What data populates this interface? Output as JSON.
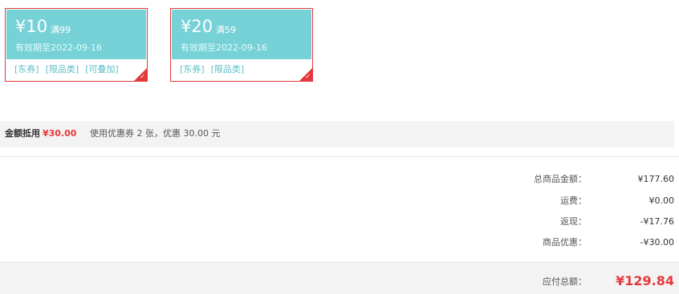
{
  "coupons": [
    {
      "amount": "¥10",
      "condition": "满99",
      "validity": "有效期至2022-09-16",
      "tags": [
        "[东券]",
        "[限品类]",
        "[可叠加]"
      ]
    },
    {
      "amount": "¥20",
      "condition": "满59",
      "validity": "有效期至2022-09-16",
      "tags": [
        "[东券]",
        "[限品类]"
      ]
    }
  ],
  "discount": {
    "label": "金额抵用",
    "value": "¥30.00",
    "summary": "使用优惠券 2 张，优惠 30.00 元"
  },
  "summary": {
    "subtotal_label": "总商品金额：",
    "subtotal_value": "¥177.60",
    "shipping_label": "运费：",
    "shipping_value": "¥0.00",
    "cashback_label": "返现：",
    "cashback_value": "-¥17.76",
    "promo_label": "商品优惠：",
    "promo_value": "-¥30.00"
  },
  "total": {
    "label": "应付总额：",
    "value": "¥129.84"
  },
  "colors": {
    "accent_red": "#e4393c",
    "coupon_teal": "#76d2d6",
    "tag_teal": "#5cbfc6"
  }
}
